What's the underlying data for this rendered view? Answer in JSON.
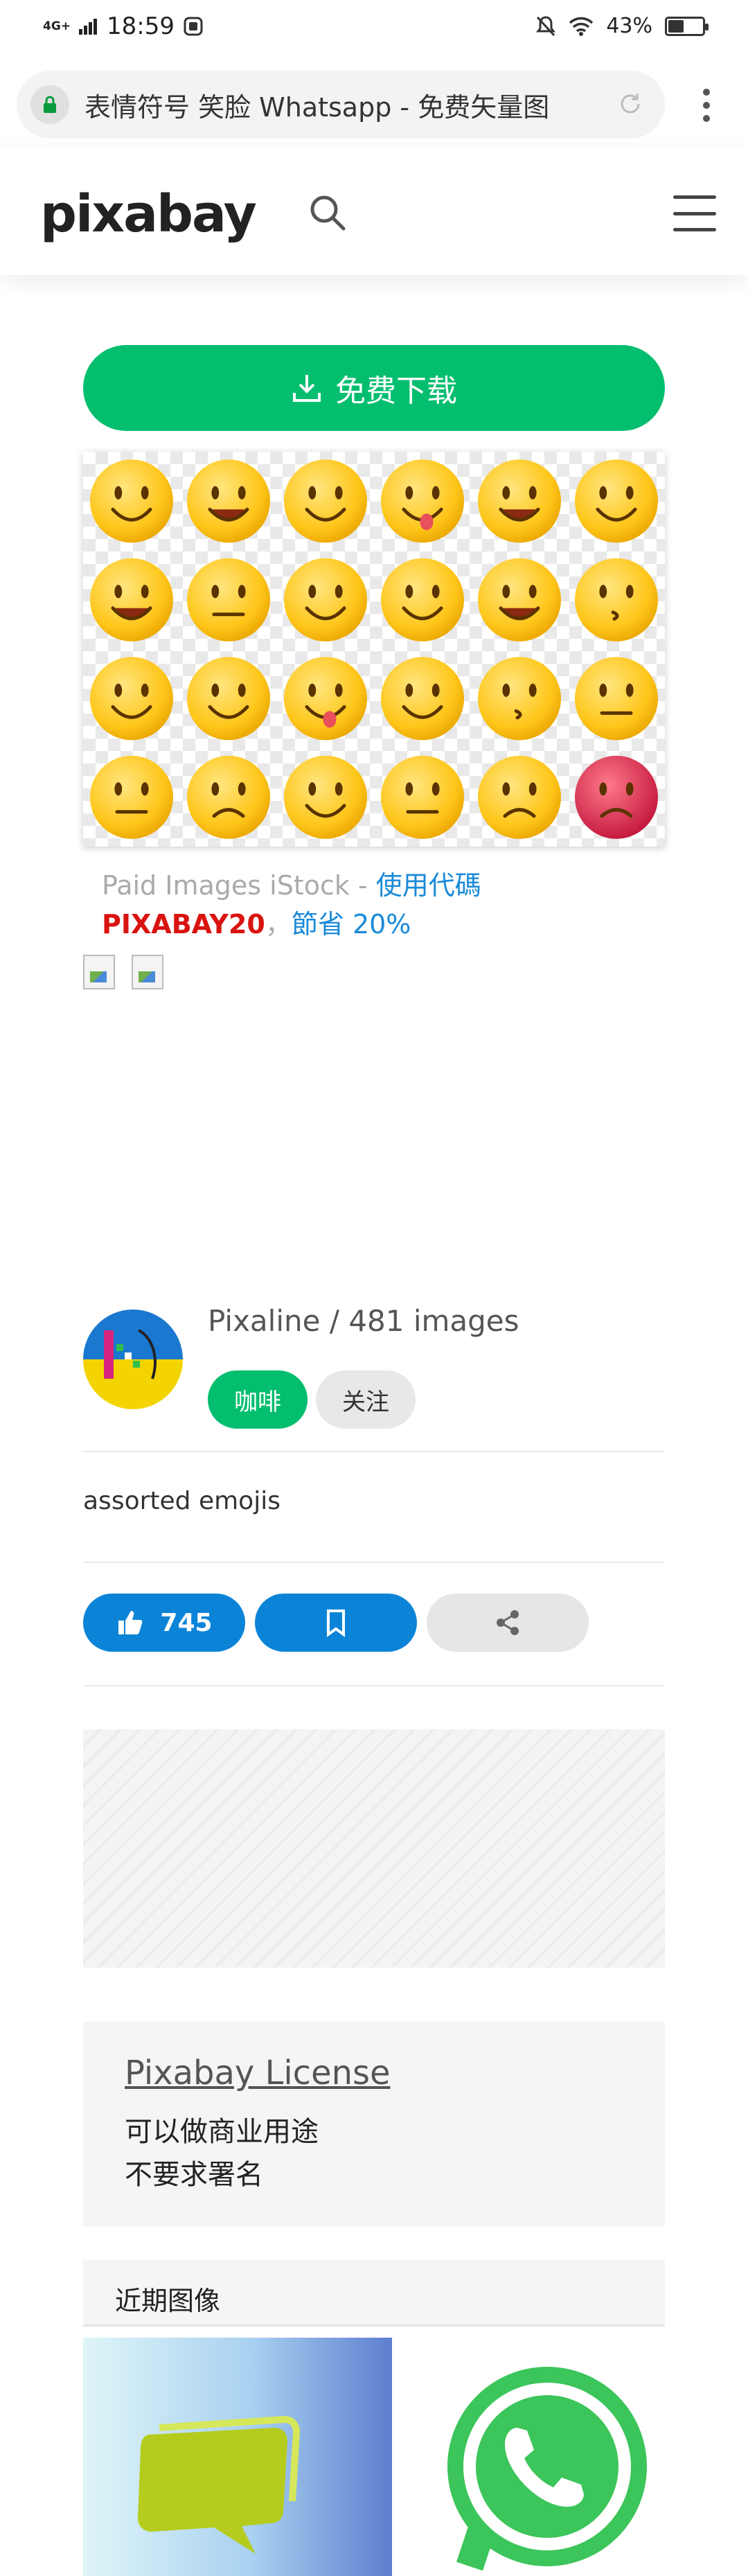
{
  "status_bar": {
    "network": "4G+",
    "time": "18:59",
    "battery": "43%"
  },
  "browser": {
    "url_text": "表情符号 笑脸 Whatsapp - 免费矢量图"
  },
  "header": {
    "logo": "pixabay"
  },
  "download": {
    "label": "免费下载"
  },
  "promo": {
    "prefix": "Paid Images iStock - ",
    "link": "使用代碼",
    "code": "PIXABAY20",
    "sep": "，",
    "saving": "節省 20%"
  },
  "author": {
    "name_line": "Pixaline / 481 images",
    "coffee_label": "咖啡",
    "follow_label": "关注"
  },
  "description": "assorted emojis",
  "actions": {
    "likes": "745"
  },
  "license": {
    "title": "Pixabay License",
    "line1": "可以做商业用途",
    "line2": "不要求署名"
  },
  "recent": {
    "title": "近期图像"
  },
  "colors": {
    "brand_green": "#02be6e",
    "action_blue": "#0b84d8",
    "promo_red": "#d9130f",
    "link_blue": "#1a8ad8"
  }
}
